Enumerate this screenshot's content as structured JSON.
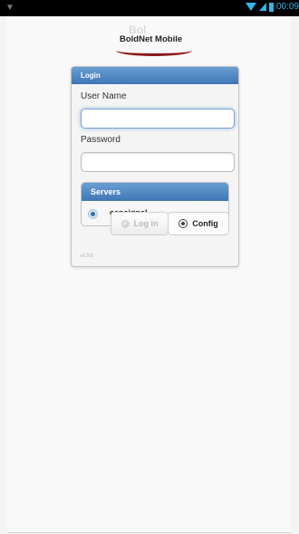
{
  "status_bar": {
    "time": "00:09"
  },
  "logo": {
    "text": "BoldNet Mobile",
    "ghost_text": "Bol"
  },
  "login": {
    "title": "Login",
    "username_label": "User Name",
    "username_value": "",
    "password_label": "Password",
    "password_value": ""
  },
  "servers": {
    "title": "Servers",
    "items": [
      {
        "name": "censignal",
        "selected": true
      }
    ]
  },
  "buttons": {
    "login_label": "Log in",
    "config_label": "Config"
  },
  "version": "v1.0.0",
  "colors": {
    "header_blue": "#4a82c0",
    "status_blue": "#33b5e5",
    "logo_red": "#8b1a1a"
  }
}
